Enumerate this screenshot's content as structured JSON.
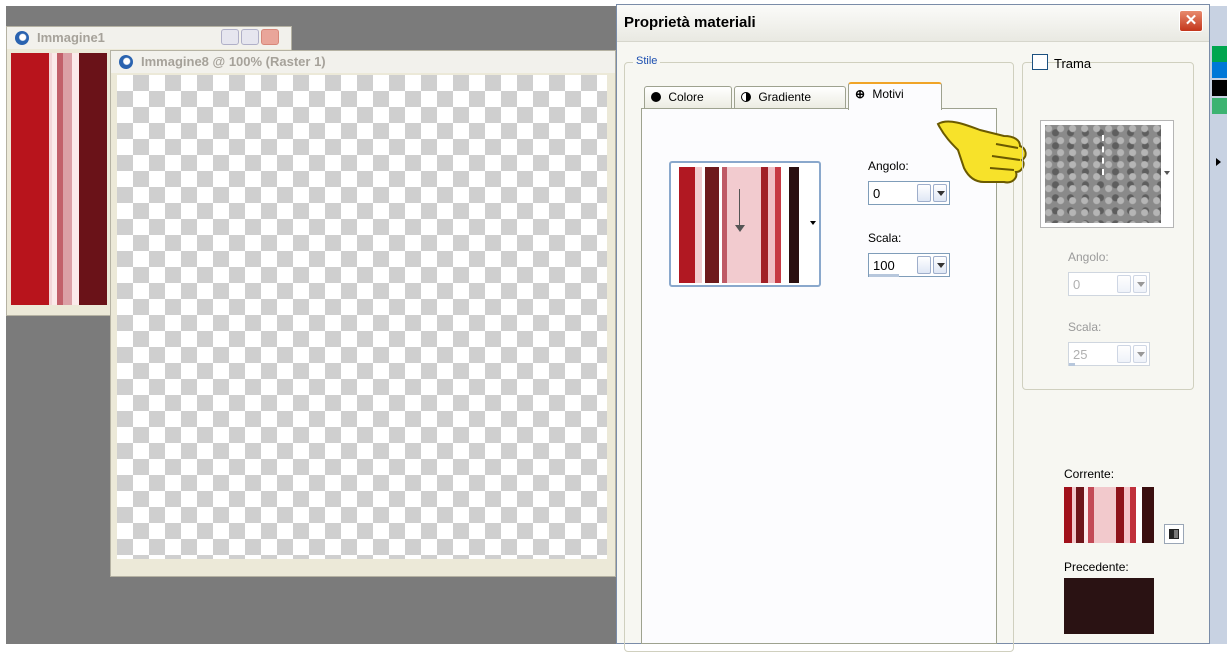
{
  "windows": {
    "immagine1": {
      "title": "Immagine1"
    },
    "immagine8": {
      "title": "Immagine8 @ 100% (Raster 1)"
    }
  },
  "dialog": {
    "title": "Proprietà materiali",
    "close": "✕",
    "stile": {
      "legend": "Stile",
      "tabs": [
        {
          "label": "Colore"
        },
        {
          "label": "Gradiente"
        },
        {
          "label": "Motivi",
          "active": true
        }
      ],
      "angolo": {
        "label": "Angolo:",
        "value": "0"
      },
      "scala": {
        "label": "Scala:",
        "value": "100"
      }
    },
    "trama": {
      "label": "Trama",
      "checked": false,
      "angolo": {
        "label": "Angolo:",
        "value": "0"
      },
      "scala": {
        "label": "Scala:",
        "value": "25"
      }
    },
    "corrente": {
      "label": "Corrente:"
    },
    "precedente": {
      "label": "Precedente:"
    }
  },
  "colors": {
    "workspace": "#7b7b7b",
    "dialog_bg": "#f7f7f2",
    "legend_text": "#1c4fb0",
    "active_tab_accent": "#f0a428",
    "close_button": "#c3361b",
    "hand_cursor": "#f7e22a",
    "previous_color": "#2a1213",
    "palette_strip": [
      "#00a64f",
      "#0078d7",
      "#000000",
      "#3cb371"
    ]
  },
  "icons": {
    "tab_colore": "filled-circle-icon",
    "tab_gradiente": "half-circle-icon",
    "tab_motivi": "crosshair-icon",
    "pointer": "hand-pointer-icon"
  }
}
